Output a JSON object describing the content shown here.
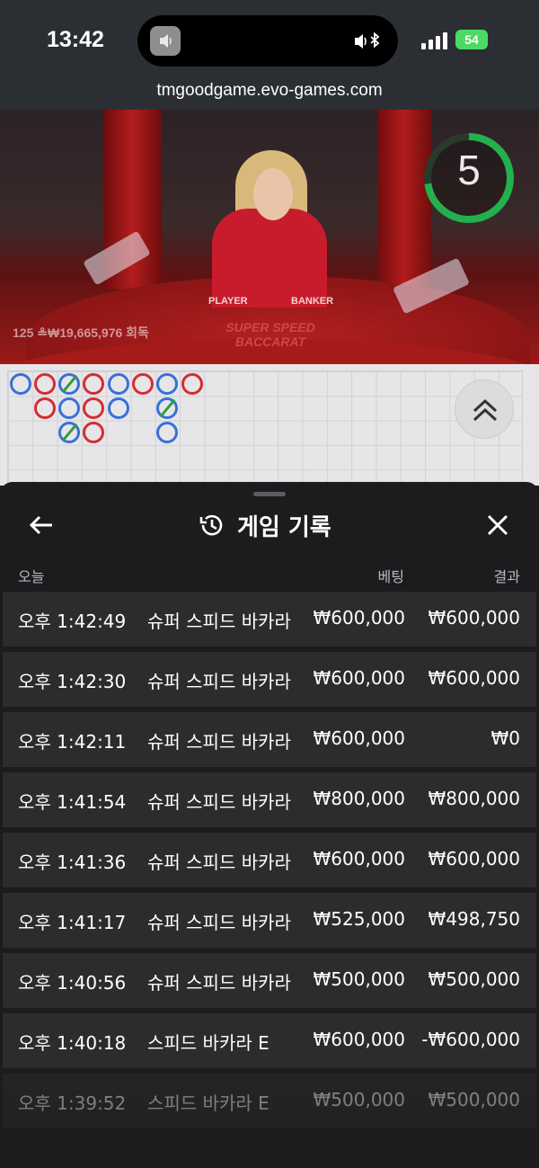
{
  "status_bar": {
    "time": "13:42",
    "battery": "54"
  },
  "browser": {
    "url": "tmgoodgame.evo-games.com"
  },
  "video": {
    "countdown": "5",
    "bet_info": "125 ≗₩19,665,976 회독",
    "table_labels": [
      "PLAYER",
      "BANKER"
    ],
    "table_brand": "SUPER SPEED BACCARAT"
  },
  "roadmap": {
    "beads": [
      {
        "col": 0,
        "row": 0,
        "color": "blue"
      },
      {
        "col": 1,
        "row": 0,
        "color": "red"
      },
      {
        "col": 2,
        "row": 0,
        "color": "blue",
        "tie": true
      },
      {
        "col": 3,
        "row": 0,
        "color": "red"
      },
      {
        "col": 4,
        "row": 0,
        "color": "blue"
      },
      {
        "col": 5,
        "row": 0,
        "color": "red"
      },
      {
        "col": 6,
        "row": 0,
        "color": "blue"
      },
      {
        "col": 7,
        "row": 0,
        "color": "red"
      },
      {
        "col": 1,
        "row": 1,
        "color": "red"
      },
      {
        "col": 2,
        "row": 1,
        "color": "blue"
      },
      {
        "col": 3,
        "row": 1,
        "color": "red"
      },
      {
        "col": 4,
        "row": 1,
        "color": "blue"
      },
      {
        "col": 6,
        "row": 1,
        "color": "blue",
        "tie": true
      },
      {
        "col": 2,
        "row": 2,
        "color": "blue",
        "tie": true
      },
      {
        "col": 3,
        "row": 2,
        "color": "red"
      },
      {
        "col": 6,
        "row": 2,
        "color": "blue"
      }
    ]
  },
  "history": {
    "title": "게임 기록",
    "section_label": "오늘",
    "col_bet": "베팅",
    "col_result": "결과",
    "rows": [
      {
        "time": "오후 1:42:49",
        "game": "슈퍼 스피드 바카라",
        "bet": "₩600,000",
        "result": "₩600,000"
      },
      {
        "time": "오후 1:42:30",
        "game": "슈퍼 스피드 바카라",
        "bet": "₩600,000",
        "result": "₩600,000"
      },
      {
        "time": "오후 1:42:11",
        "game": "슈퍼 스피드 바카라",
        "bet": "₩600,000",
        "result": "₩0"
      },
      {
        "time": "오후 1:41:54",
        "game": "슈퍼 스피드 바카라",
        "bet": "₩800,000",
        "result": "₩800,000"
      },
      {
        "time": "오후 1:41:36",
        "game": "슈퍼 스피드 바카라",
        "bet": "₩600,000",
        "result": "₩600,000"
      },
      {
        "time": "오후 1:41:17",
        "game": "슈퍼 스피드 바카라",
        "bet": "₩525,000",
        "result": "₩498,750"
      },
      {
        "time": "오후 1:40:56",
        "game": "슈퍼 스피드 바카라",
        "bet": "₩500,000",
        "result": "₩500,000"
      },
      {
        "time": "오후 1:40:18",
        "game": "스피드 바카라 E",
        "bet": "₩600,000",
        "result": "-₩600,000"
      },
      {
        "time": "오후 1:39:52",
        "game": "스피드 바카라 E",
        "bet": "₩500,000",
        "result": "₩500,000"
      }
    ]
  }
}
